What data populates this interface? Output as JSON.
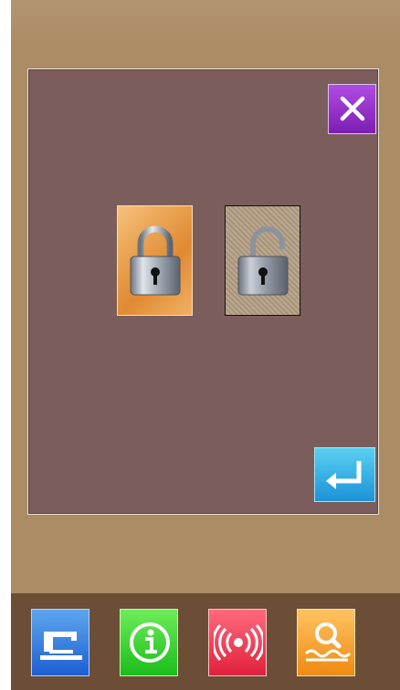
{
  "screen": {
    "background": "#ac8c64",
    "panel": "#7b5e5c"
  },
  "dialog": {
    "close_button": {
      "icon": "close-icon",
      "color": "#9b32cf"
    },
    "lock_options": [
      {
        "id": "locked",
        "icon": "padlock-locked-icon",
        "state": "selected",
        "color": "#f0a24a"
      },
      {
        "id": "unlocked",
        "icon": "padlock-unlocked-icon",
        "state": "unselected"
      }
    ],
    "enter_button": {
      "icon": "enter-return-icon",
      "color": "#2aa9e3"
    }
  },
  "toolbar": [
    {
      "icon": "sewing-machine-icon",
      "color": "#2f7fe3"
    },
    {
      "icon": "info-icon",
      "color": "#35d132"
    },
    {
      "icon": "signal-waves-icon",
      "color": "#f23e55"
    },
    {
      "icon": "search-icon",
      "color": "#f7a12c"
    }
  ]
}
